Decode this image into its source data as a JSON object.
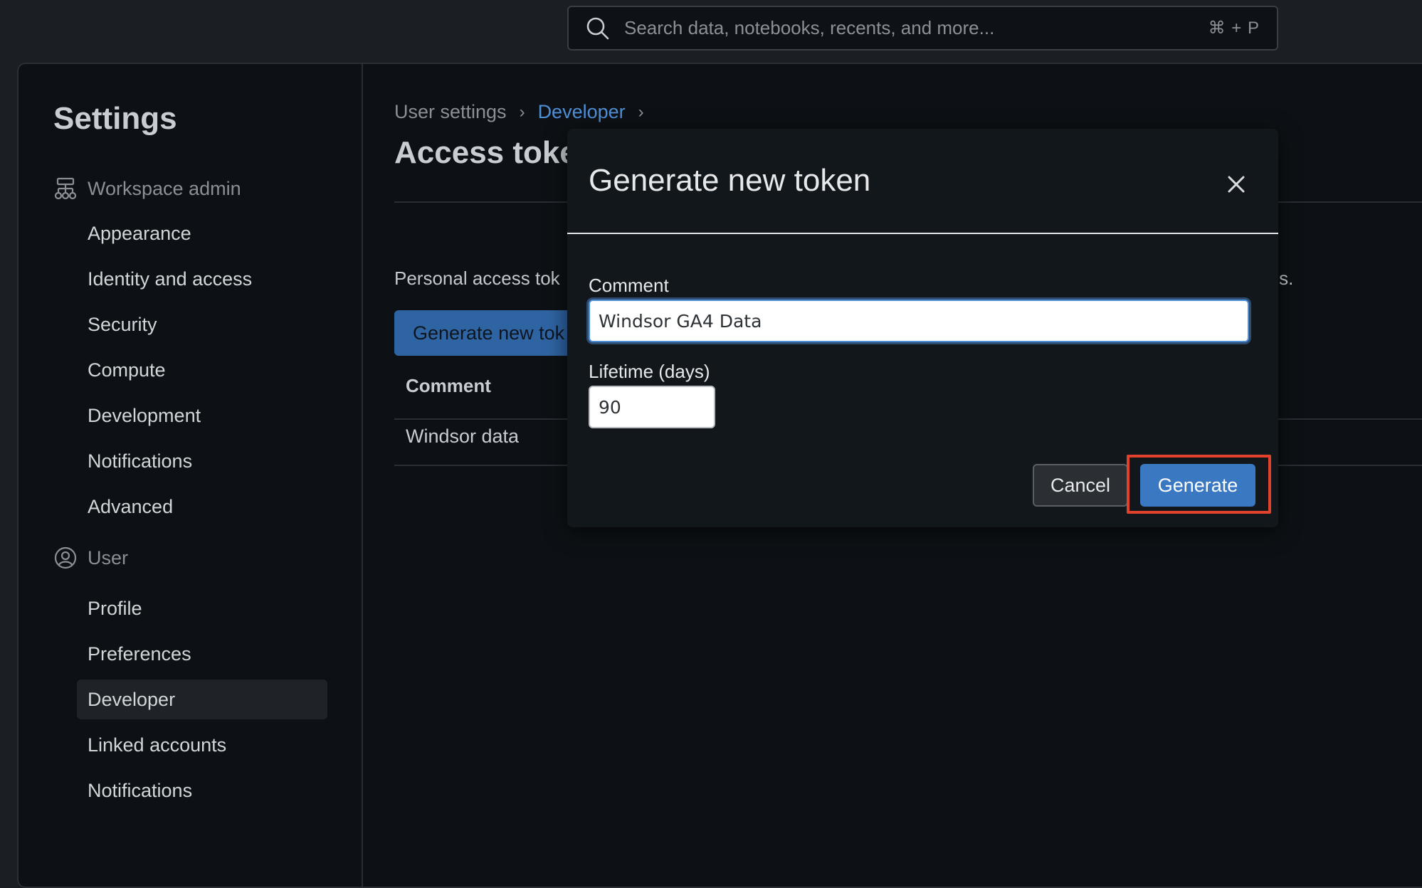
{
  "search": {
    "placeholder": "Search data, notebooks, recents, and more...",
    "shortcut": "⌘ + P"
  },
  "sidebar": {
    "title": "Settings",
    "workspace_admin": {
      "label": "Workspace admin",
      "items": [
        {
          "label": "Appearance"
        },
        {
          "label": "Identity and access"
        },
        {
          "label": "Security"
        },
        {
          "label": "Compute"
        },
        {
          "label": "Development"
        },
        {
          "label": "Notifications"
        },
        {
          "label": "Advanced"
        }
      ]
    },
    "user": {
      "label": "User",
      "items": [
        {
          "label": "Profile"
        },
        {
          "label": "Preferences"
        },
        {
          "label": "Developer",
          "active": true
        },
        {
          "label": "Linked accounts"
        },
        {
          "label": "Notifications"
        }
      ]
    }
  },
  "breadcrumb": {
    "items": [
      "User settings",
      "Developer"
    ],
    "separator": "›"
  },
  "page": {
    "title_visible": "Access toke",
    "description_visible": "Personal access tok",
    "description_tail": "rds.",
    "generate_button_visible": "Generate new tok",
    "table": {
      "header": "Comment",
      "rows": [
        {
          "comment": "Windsor data"
        }
      ]
    }
  },
  "modal": {
    "title": "Generate new token",
    "comment_label": "Comment",
    "comment_value": "Windsor GA4 Data",
    "lifetime_label": "Lifetime (days)",
    "lifetime_value": "90",
    "cancel_label": "Cancel",
    "generate_label": "Generate"
  },
  "colors": {
    "accent": "#3a78c2",
    "link": "#4f8fd6",
    "highlight": "#e2412c",
    "background": "#0d1115"
  },
  "icons": {
    "search": "search-icon",
    "workspace_admin": "org-hierarchy-icon",
    "user": "user-circle-icon",
    "close": "close-icon",
    "breadcrumb_separator": "chevron-right-icon"
  }
}
